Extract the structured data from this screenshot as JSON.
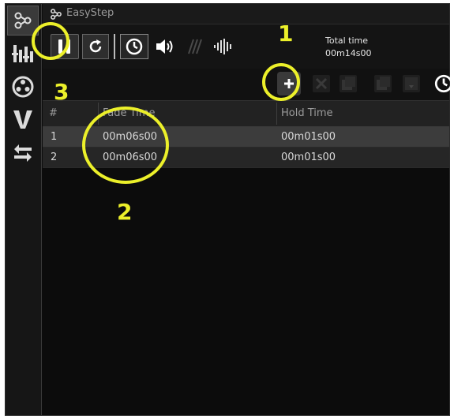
{
  "app": {
    "title": "EasyStep"
  },
  "toolbar": {
    "total_label": "Total time",
    "total_value": "00m14s00"
  },
  "table": {
    "columns": [
      "#",
      "Fade Time",
      "Hold Time"
    ],
    "rows": [
      {
        "index": "1",
        "fade": "00m06s00",
        "hold": "00m01s00",
        "selected": true
      },
      {
        "index": "2",
        "fade": "00m06s00",
        "hold": "00m01s00",
        "selected": false
      }
    ]
  },
  "annotations": {
    "one": "1",
    "two": "2",
    "three": "3"
  },
  "colors": {
    "highlight": "#ecf02a",
    "background": "#0c0c0c",
    "selected_row": "#3c3c3c"
  },
  "icons": {
    "sidebar": [
      "easystep-icon",
      "faders-icon",
      "color-wheel-icon",
      "beam-icon",
      "swap-icon"
    ],
    "toolbar": [
      "pause-icon",
      "loop-icon",
      "clock-icon",
      "speaker-icon",
      "wave-disabled-icon",
      "waveform-icon"
    ],
    "row2": [
      "add-icon",
      "delete-icon",
      "copy-icon",
      "paste-icon",
      "insert-icon",
      "clock-icon"
    ]
  }
}
